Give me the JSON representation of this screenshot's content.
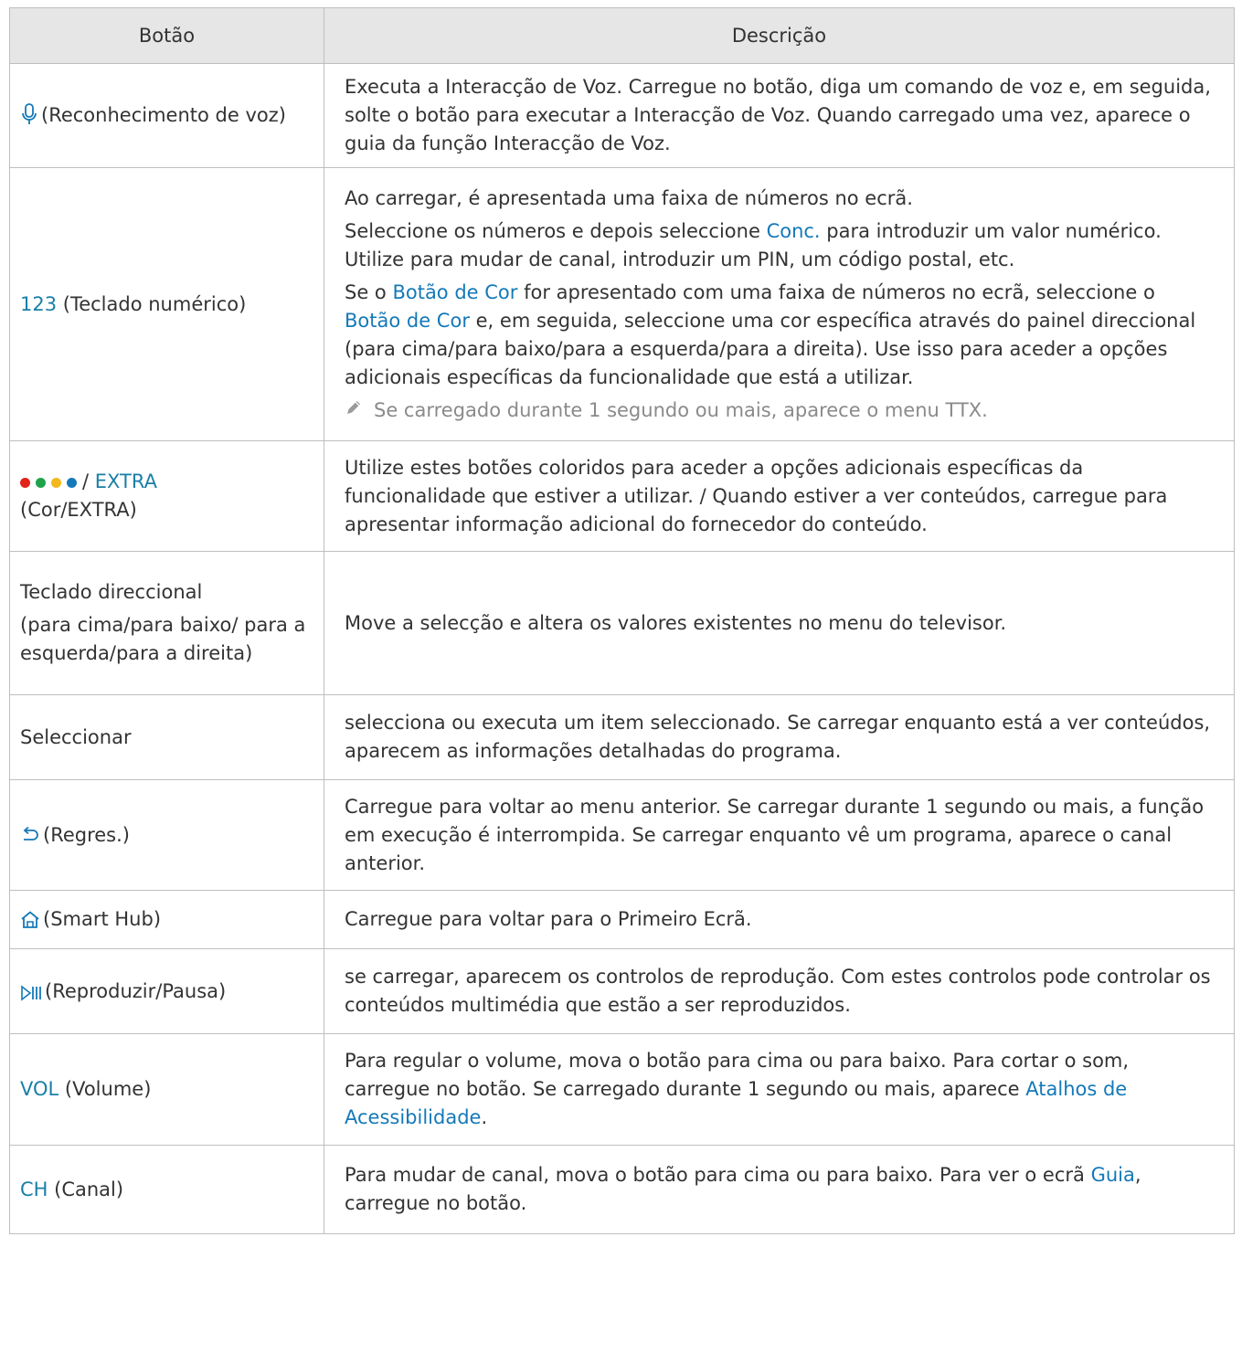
{
  "header": {
    "col1": "Botão",
    "col2": "Descrição"
  },
  "colors": {
    "red": "#e2231a",
    "green": "#1fa34a",
    "yellow": "#f4b81c",
    "blue": "#1479b8"
  },
  "rows": [
    {
      "label": "(Reconhecimento de voz)",
      "icon": "microphone-icon",
      "desc": "Executa a Interacção de Voz. Carregue no botão, diga um comando de voz e, em seguida, solte o botão para executar a Interacção de Voz. Quando carregado uma vez, aparece o guia da função Interacção de Voz."
    },
    {
      "key": "123",
      "label": " (Teclado numérico)",
      "p1": "Ao carregar, é apresentada uma faixa de números no ecrã.",
      "p2a": "Seleccione os números e depois seleccione ",
      "p2b": "Conc.",
      "p2c": " para introduzir um valor numérico. Utilize para mudar de canal, introduzir um PIN, um código postal, etc.",
      "p3a": "Se o ",
      "p3b": "Botão de Cor",
      "p3c": " for apresentado com uma faixa de números no ecrã, seleccione o ",
      "p3d": "Botão de Cor",
      "p3e": " e, em seguida, seleccione uma cor específica através do painel direccional (para cima/para baixo/para a esquerda/para a direita). Use isso para aceder a opções adicionais específicas da funcionalidade que está a utilizar.",
      "note": "Se carregado durante 1 segundo ou mais, aparece o menu TTX.",
      "note_icon": "pencil-icon"
    },
    {
      "sep": "/ ",
      "key": "EXTRA",
      "label": "(Cor/EXTRA)",
      "desc": "Utilize estes botões coloridos para aceder a opções adicionais específicas da funcionalidade que estiver a utilizar. / Quando estiver a ver conteúdos, carregue para apresentar informação adicional do fornecedor do conteúdo."
    },
    {
      "label1": "Teclado direccional",
      "label2": "(para cima/para baixo/ para a esquerda/para a direita)",
      "desc": "Move a selecção e altera os valores existentes no menu do televisor."
    },
    {
      "label": "Seleccionar",
      "desc": "selecciona ou executa um item seleccionado. Se carregar enquanto está a ver conteúdos, aparecem as informações detalhadas do programa."
    },
    {
      "label": "(Regres.)",
      "icon": "return-arrow-icon",
      "desc": "Carregue para voltar ao menu anterior. Se carregar durante 1 segundo ou mais, a função em execução é interrompida. Se carregar enquanto vê um programa, aparece o canal anterior."
    },
    {
      "label": "(Smart Hub)",
      "icon": "home-icon",
      "desc": "Carregue para voltar para o Primeiro Ecrã."
    },
    {
      "label": "(Reproduzir/Pausa)",
      "icon": "play-pause-icon",
      "desc": "se carregar, aparecem os controlos de reprodução. Com estes controlos pode controlar os conteúdos multimédia que estão a ser reproduzidos."
    },
    {
      "key": "VOL",
      "label": " (Volume)",
      "desc_a": "Para regular o volume, mova o botão para cima ou para baixo. Para cortar o som, carregue no botão. Se carregado durante 1 segundo ou mais, aparece ",
      "desc_b": "Atalhos de Acessibilidade",
      "desc_c": "."
    },
    {
      "key": "CH",
      "label": " (Canal)",
      "desc_a": "Para mudar de canal, mova o botão para cima ou para baixo. Para ver o ecrã ",
      "desc_b": "Guia",
      "desc_c": ", carregue no botão."
    }
  ]
}
